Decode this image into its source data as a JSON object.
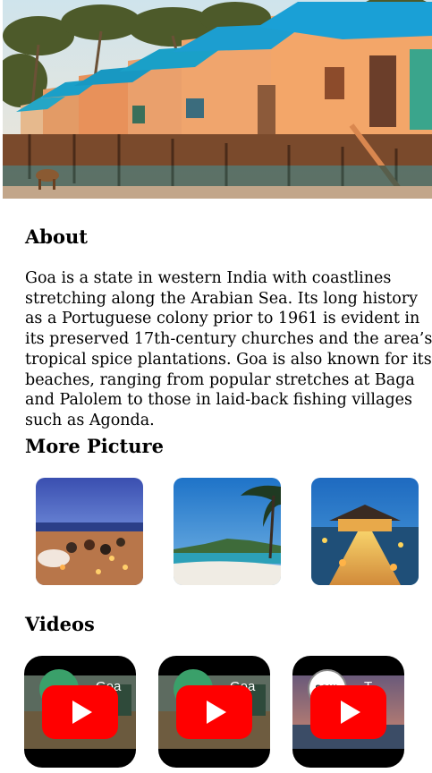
{
  "hero": {
    "image": "goa-beach-huts-photo"
  },
  "about": {
    "title": "About",
    "text": "Goa is a state in western India with coastlines stretching along the Arabian Sea. Its long history as a Portuguese colony prior to 1961 is evident in its preserved 17th-century churches and the area’s tropical spice plantations. Goa is also known for its beaches, ranging from popular stretches at Baga and Palolem to those in laid-back fishing villages such as Agonda."
  },
  "more_pictures": {
    "title": "More Picture",
    "items": [
      {
        "image": "beach-party-night-photo"
      },
      {
        "image": "palm-beach-photo"
      },
      {
        "image": "water-villa-pier-photo"
      }
    ]
  },
  "videos": {
    "title": "Videos",
    "items": [
      {
        "title": "Goa",
        "avatar": "green-palm-avatar",
        "icon": "play-icon"
      },
      {
        "title": "Goa",
        "avatar": "green-palm-avatar",
        "icon": "play-icon"
      },
      {
        "title": "T",
        "avatar_text": "SOUL",
        "icon": "play-icon"
      }
    ]
  },
  "colors": {
    "play": "#ff0000",
    "hut_roof": "#1aa0c8",
    "hut_wall": "#e8915a"
  }
}
